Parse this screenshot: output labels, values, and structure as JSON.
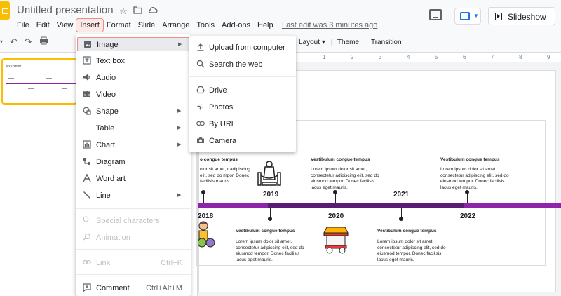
{
  "app": {
    "doc_title": "Untitled presentation",
    "last_edit": "Last edit was 3 minutes ago",
    "slideshow_label": "Slideshow"
  },
  "menubar": [
    "File",
    "Edit",
    "View",
    "Insert",
    "Format",
    "Slide",
    "Arrange",
    "Tools",
    "Add-ons",
    "Help"
  ],
  "toolbar": {
    "layout": "Layout",
    "theme": "Theme",
    "transition": "Transition"
  },
  "ruler": [
    "1",
    "2",
    "3",
    "4",
    "5",
    "6",
    "7",
    "8",
    "9"
  ],
  "thumbnail": {
    "title": "My Timeline"
  },
  "insert_menu": {
    "image": "Image",
    "text_box": "Text box",
    "audio": "Audio",
    "video": "Video",
    "shape": "Shape",
    "table": "Table",
    "chart": "Chart",
    "diagram": "Diagram",
    "word_art": "Word art",
    "line": "Line",
    "special_characters": "Special characters",
    "animation": "Animation",
    "link": "Link",
    "link_shortcut": "Ctrl+K",
    "comment": "Comment",
    "comment_shortcut": "Ctrl+Alt+M"
  },
  "image_submenu": {
    "upload": "Upload from computer",
    "search": "Search the web",
    "drive": "Drive",
    "photos": "Photos",
    "by_url": "By URL",
    "camera": "Camera"
  },
  "slide": {
    "years": [
      "2018",
      "2019",
      "2020",
      "2021",
      "2022"
    ],
    "event_title": "Vestibulum congue tempus",
    "event_title_cut": "o congue tempus",
    "event_body": "Lorem ipsum dolor sit amet, consectetur adipiscing elit, sed do eiusmod tempor. Donec facilisis lacus eget mauris.",
    "event_body_cut": "olor sit amet, r adipiscing elit, sed do mpor. Donec facilisis mauris."
  },
  "colors": {
    "timeline": "#8e24aa",
    "timeline_dark": "#5b1a73",
    "accent": "#1a73e8",
    "logo": "#fbbc04",
    "highlight_border": "#f28b82"
  }
}
